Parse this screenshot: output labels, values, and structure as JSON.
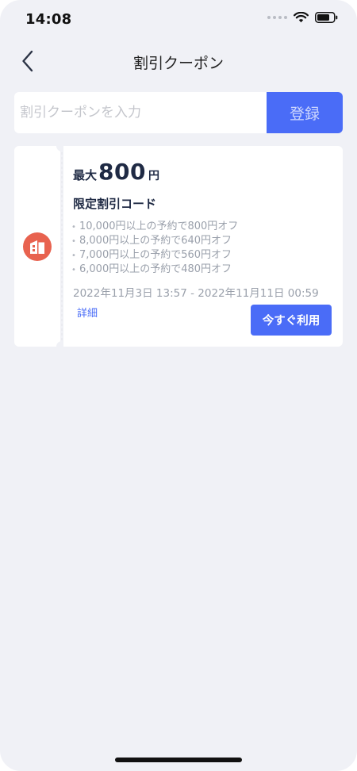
{
  "status_bar": {
    "time": "14:08",
    "icons": [
      "signal-dots-icon",
      "wifi-icon",
      "battery-icon"
    ]
  },
  "nav": {
    "back_icon": "chevron-left-icon",
    "title": "割引クーポン"
  },
  "coupon_input": {
    "placeholder": "割引クーポンを入力",
    "value": "",
    "register_label": "登録"
  },
  "coupon": {
    "icon": "hotel-building-icon",
    "amount_prefix": "最大",
    "amount_value": "800",
    "amount_unit": "円",
    "code_title": "限定割引コード",
    "conditions": [
      "10,000円以上の予約で800円オフ",
      "8,000円以上の予約で640円オフ",
      "7,000円以上の予約で560円オフ",
      "6,000円以上の予約で480円オフ"
    ],
    "validity": "2022年11月3日 13:57 - 2022年11月11日 00:59",
    "details_label": "詳細",
    "use_now_label": "今すぐ利用"
  },
  "colors": {
    "background": "#f0f1f6",
    "accent": "#4a6cf7",
    "badge": "#e8624f",
    "text_dark": "#1f2a44",
    "text_muted": "#9aa0ab"
  }
}
